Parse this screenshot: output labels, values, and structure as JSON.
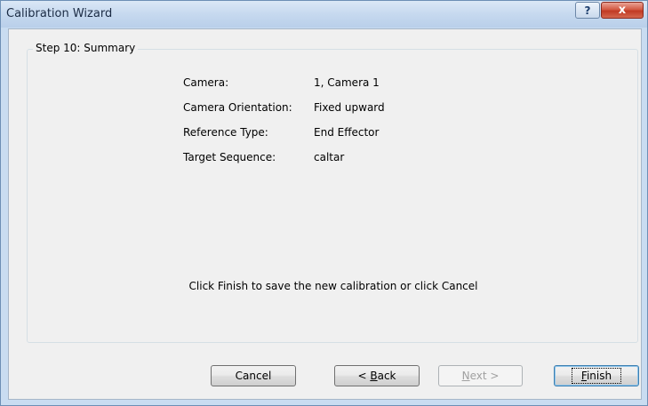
{
  "window": {
    "title": "Calibration Wizard",
    "help_glyph": "?",
    "close_glyph": "x"
  },
  "group": {
    "legend": "Step 10: Summary"
  },
  "summary": [
    {
      "label": "Camera:",
      "value": "1, Camera 1"
    },
    {
      "label": "Camera Orientation:",
      "value": "Fixed upward"
    },
    {
      "label": "Reference Type:",
      "value": "End Effector"
    },
    {
      "label": "Target Sequence:",
      "value": "caltar"
    }
  ],
  "instruction": "Click Finish to save the new calibration or click Cancel",
  "buttons": {
    "cancel": "Cancel",
    "back_prefix": "< ",
    "back_accel": "B",
    "back_rest": "ack",
    "next_accel": "N",
    "next_rest": "ext >",
    "finish_accel": "F",
    "finish_rest": "inish"
  }
}
